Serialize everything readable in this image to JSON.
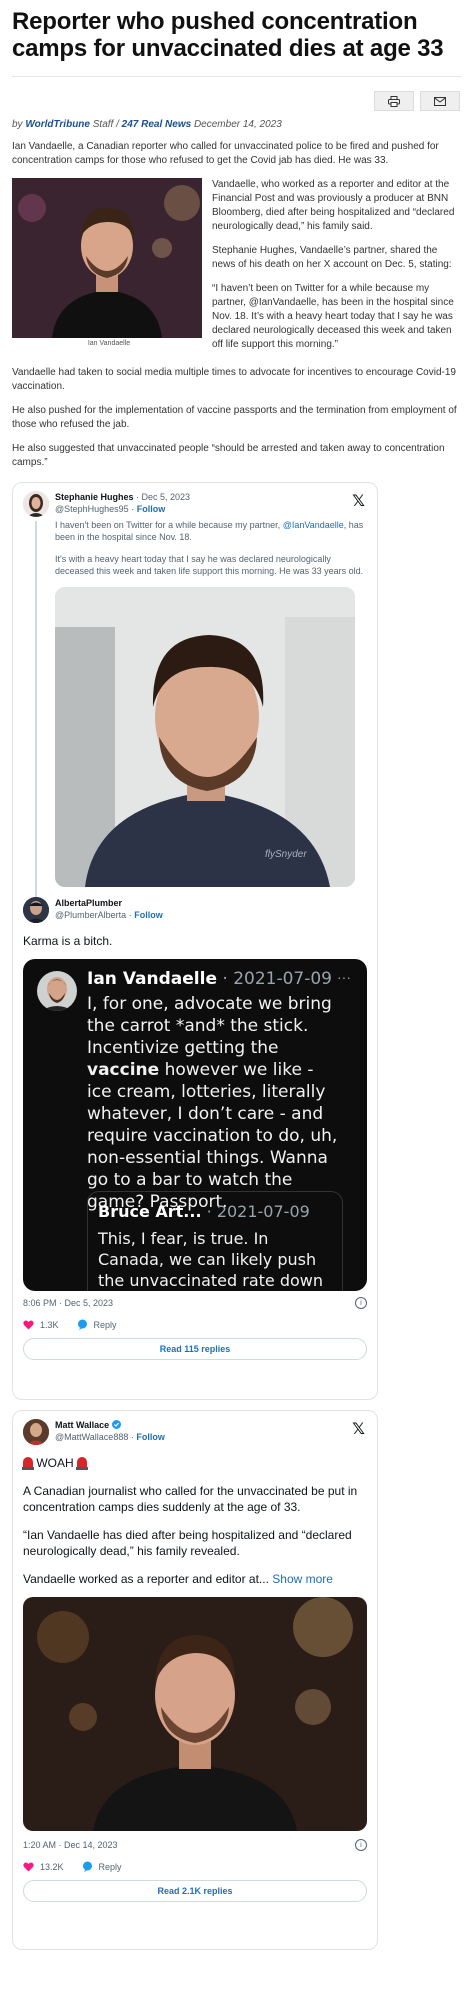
{
  "article": {
    "title": "Reporter who pushed concentration camps for unvaccinated dies at age 33",
    "byline": {
      "prefix": "by",
      "author": "WorldTribune",
      "staff": "Staff /",
      "source": "247 Real News",
      "date": "December 14, 2023"
    },
    "tools": {
      "print_icon": "printer-icon",
      "email_icon": "envelope-icon"
    },
    "intro": "Ian Vandaelle, a Canadian reporter who called for unvaccinated police to be fired and pushed for concentration camps for those who refused to get the Covid jab has died. He was 33.",
    "figure_caption": "Ian Vandaelle",
    "para2": "Vandaelle, who worked as a reporter and editor at the Financial Post and was proviously a producer at BNN Bloomberg, died after being hospitalized and “declared neurologically dead,” his family said.",
    "para3": "Stephanie Hughes, Vandaelle’s partner, shared the news of his death on her X account on Dec. 5, stating:",
    "quote": "“I haven’t been on Twitter for a while because my partner, @IanVandaelle, has been in the hospital since Nov. 18. It’s with a heavy heart today that I say he was declared neurologically deceased this week and taken off life support this morning.”",
    "para5": "Vandaelle had taken to social media multiple times to advocate for incentives to encourage Covid-19 vaccination.",
    "para6": "He also pushed for the implementation of vaccine passports and the termination from employment of those who refused the jab.",
    "para7": "He also suggested that unvaccinated people “should be arrested and taken away to concentration camps.”"
  },
  "tweet1": {
    "name": "Stephanie Hughes",
    "date": "· Dec 5, 2023",
    "handle": "@StephHughes95",
    "follow": "Follow",
    "x_logo": "𝕏",
    "line1": "I haven't been on Twitter for a while because my partner,",
    "mention": "@IanVandaelle",
    "line2": ", has been in the hospital since Nov. 18.",
    "line3": "It's with a heavy heart today that I say he was declared neurologically deceased this week and taken life support this morning. He was 33 years old.",
    "reply": {
      "name": "AlbertaPlumber",
      "handle": "@PlumberAlberta",
      "follow": "Follow",
      "text": "Karma is a bitch."
    },
    "embed": {
      "name": "Ian Vandaelle",
      "date": "· 2021-07-09",
      "dots": "···",
      "text_before": "I, for one, advocate we bring the carrot *and* the stick. Incentivize getting the ",
      "text_bold": "vaccine",
      "text_after": " however we like - ice cream, lotteries, literally whatever, I don’t care - and require vaccination to do, uh, non-essential things. Wanna go to a bar to watch the game? Passport.",
      "quoted_name": "Bruce Art...",
      "quoted_date": "· 2021-07-09",
      "quoted_text": "This, I fear, is true. In Canada, we can likely push the unvaccinated rate down"
    },
    "timestamp": "8:06 PM · Dec 5, 2023",
    "likes": "1.3K",
    "reply_label": "Reply",
    "read_replies": "Read 115 replies"
  },
  "tweet2": {
    "name": "Matt Wallace",
    "handle": "@MattWallace888",
    "follow": "Follow",
    "x_logo": "𝕏",
    "headline": "WOAH",
    "para1": "A Canadian journalist who called for the unvaccinated be put in concentration camps dies suddenly at the age of 33.",
    "para2": "“Ian Vandaelle has died after being hospitalized and “declared neurologically dead,” his family revealed.",
    "para3": "Vandaelle worked as a reporter and editor at...",
    "show_more": "Show more",
    "timestamp": "1:20 AM · Dec 14, 2023",
    "likes": "13.2K",
    "reply_label": "Reply",
    "read_replies": "Read 2.1K replies"
  },
  "colors": {
    "link": "#1d6fb8",
    "like_heart": "#f91880",
    "dark_embed": "#0d0d0d"
  }
}
